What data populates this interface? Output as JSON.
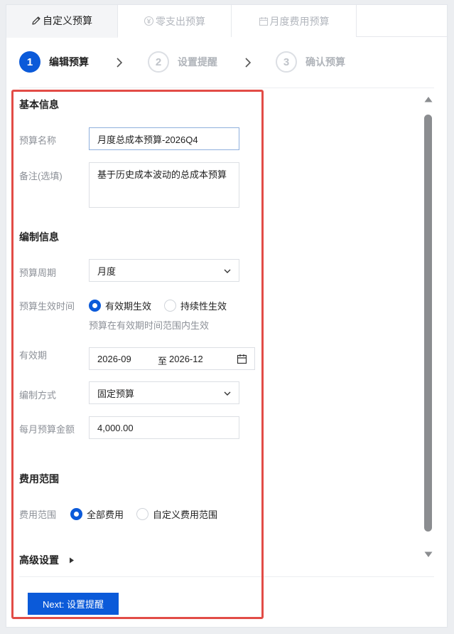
{
  "tabs": [
    {
      "label": "自定义预算",
      "icon": "pencil-icon",
      "active": true
    },
    {
      "label": "零支出预算",
      "icon": "yen-coin-icon",
      "active": false
    },
    {
      "label": "月度费用预算",
      "icon": "calendar-icon",
      "active": false
    }
  ],
  "steps": [
    {
      "num": "1",
      "label": "编辑预算",
      "active": true
    },
    {
      "num": "2",
      "label": "设置提醒",
      "active": false
    },
    {
      "num": "3",
      "label": "确认预算",
      "active": false
    }
  ],
  "basic": {
    "title": "基本信息",
    "name_label": "预算名称",
    "name_value": "月度总成本预算-2026Q4",
    "note_label": "备注(选填)",
    "note_value": "基于历史成本波动的总成本预算"
  },
  "compile": {
    "title": "编制信息",
    "period_label": "预算周期",
    "period_value": "月度",
    "effective_label": "预算生效时间",
    "effective_options": [
      "有效期生效",
      "持续性生效"
    ],
    "effective_selected": "有效期生效",
    "effective_hint": "预算在有效期时间范围内生效",
    "validity_label": "有效期",
    "validity_start": "2026-09",
    "validity_sep": "至",
    "validity_end": "2026-12",
    "method_label": "编制方式",
    "method_value": "固定预算",
    "monthly_label": "每月预算金额",
    "monthly_value": "4,000.00"
  },
  "scope": {
    "title": "费用范围",
    "label": "费用范围",
    "options": [
      "全部费用",
      "自定义费用范围"
    ],
    "selected": "全部费用"
  },
  "advanced": {
    "label": "高级设置"
  },
  "footer": {
    "next_label": "Next: 设置提醒"
  },
  "colors": {
    "primary": "#0b5ad9",
    "highlight": "#e24c46"
  }
}
